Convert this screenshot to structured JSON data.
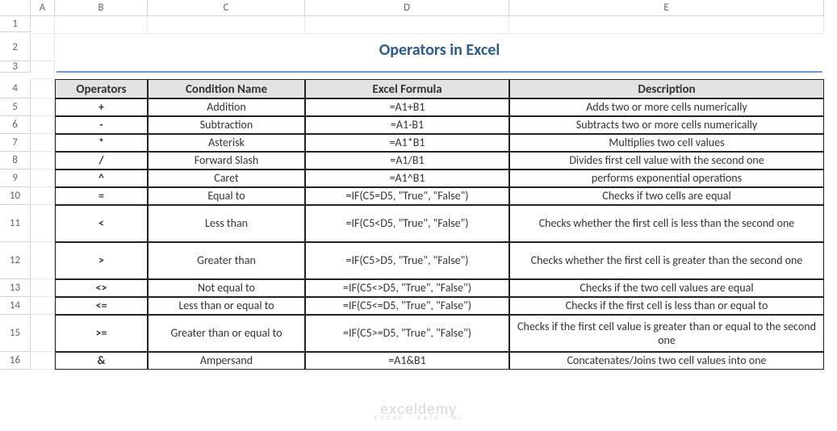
{
  "columns": [
    "A",
    "B",
    "C",
    "D",
    "E"
  ],
  "rows": [
    "1",
    "2",
    "3",
    "4",
    "5",
    "6",
    "7",
    "8",
    "9",
    "10",
    "11",
    "12",
    "13",
    "14",
    "15",
    "16"
  ],
  "title": "Operators in Excel",
  "headers": {
    "b": "Operators",
    "c": "Condition Name",
    "d": "Excel Formula",
    "e": "Description"
  },
  "data": [
    {
      "op": "+",
      "name": "Addition",
      "formula": "=A1+B1",
      "desc": "Adds two or more cells numerically",
      "tall": false
    },
    {
      "op": "-",
      "name": "Subtraction",
      "formula": "=A1-B1",
      "desc": "Subtracts two or more cells numerically",
      "tall": false
    },
    {
      "op": "*",
      "name": "Asterisk",
      "formula": "=A1*B1",
      "desc": "Multiplies two cell values",
      "tall": false
    },
    {
      "op": "/",
      "name": "Forward Slash",
      "formula": "=A1/B1",
      "desc": "Divides first cell value with the second one",
      "tall": false
    },
    {
      "op": "^",
      "name": "Caret",
      "formula": "=A1^B1",
      "desc": "performs exponential operations",
      "tall": false
    },
    {
      "op": "=",
      "name": "Equal to",
      "formula": "=IF(C5=D5, \"True\", \"False\")",
      "desc": "Checks if two cells are equal",
      "tall": false
    },
    {
      "op": "<",
      "name": "Less than",
      "formula": "=IF(C5<D5, \"True\", \"False\")",
      "desc": "Checks whether the first cell is less than the second one",
      "tall": true
    },
    {
      "op": ">",
      "name": "Greater than",
      "formula": "=IF(C5>D5, \"True\", \"False\")",
      "desc": "Checks whether the first cell is greater than the second one",
      "tall": true
    },
    {
      "op": "<>",
      "name": "Not equal to",
      "formula": "=IF(C5<>D5, \"True\", \"False\")",
      "desc": "Checks if the two cell values are equal",
      "tall": false
    },
    {
      "op": "<=",
      "name": "Less than or equal to",
      "formula": "=IF(C5<=D5, \"True\", \"False\")",
      "desc": "Checks if the first cell is less than or equal to",
      "tall": false
    },
    {
      "op": ">=",
      "name": "Greater than or equal to",
      "formula": "=IF(C5>=D5, \"True\", \"False\")",
      "desc": "Checks if the first cell value is greater than or equal to the second one",
      "tall": true
    },
    {
      "op": "&",
      "name": "Ampersand",
      "formula": "=A1&B1",
      "desc": "Concatenates/Joins two cell values into one",
      "tall": false
    }
  ],
  "watermark": {
    "title": "exceldemy",
    "sub": "EXCEL · DATA · BI"
  }
}
